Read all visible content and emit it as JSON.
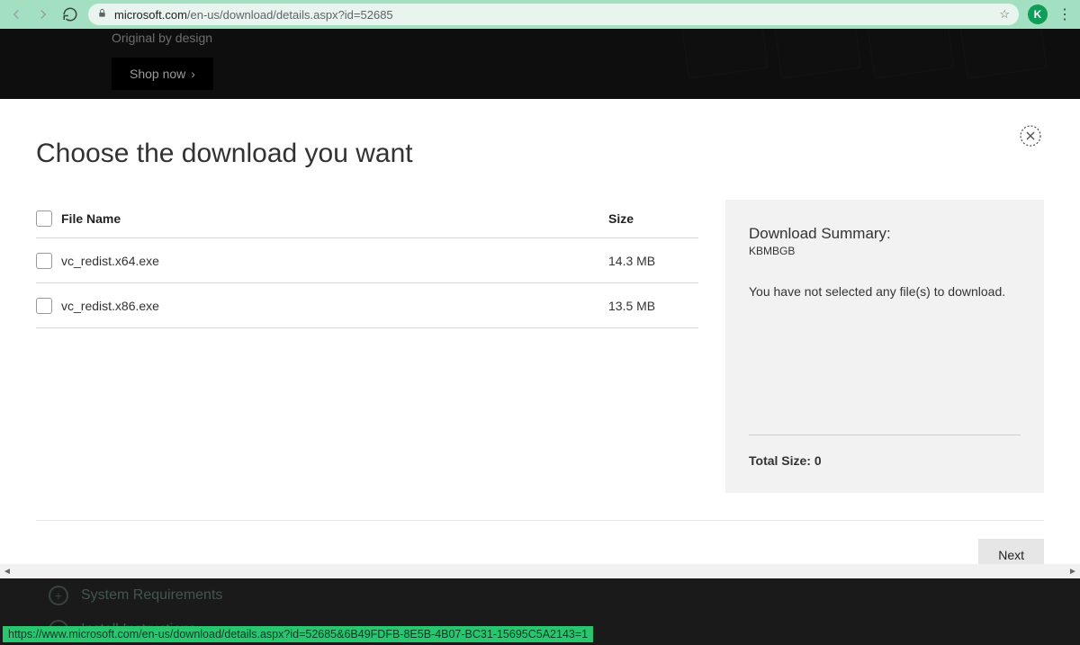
{
  "chrome": {
    "url_domain": "microsoft.com",
    "url_path": "/en-us/download/details.aspx?id=52685",
    "profile_initial": "K"
  },
  "hero": {
    "tagline": "Original by design",
    "shop_label": "Shop now"
  },
  "modal": {
    "title": "Choose the download you want",
    "columns": {
      "file": "File Name",
      "size": "Size"
    },
    "rows": [
      {
        "name": "vc_redist.x64.exe",
        "size": "14.3 MB"
      },
      {
        "name": "vc_redist.x86.exe",
        "size": "13.5 MB"
      }
    ],
    "summary": {
      "title": "Download Summary:",
      "subtitle": "KBMBGB",
      "message": "You have not selected any file(s) to download.",
      "total_label": "Total Size: 0"
    },
    "next_label": "Next"
  },
  "footer": {
    "items": [
      "System Requirements",
      "Install Instructions"
    ],
    "status_url": "https://www.microsoft.com/en-us/download/details.aspx?id=52685&6B49FDFB-8E5B-4B07-BC31-15695C5A2143=1"
  }
}
